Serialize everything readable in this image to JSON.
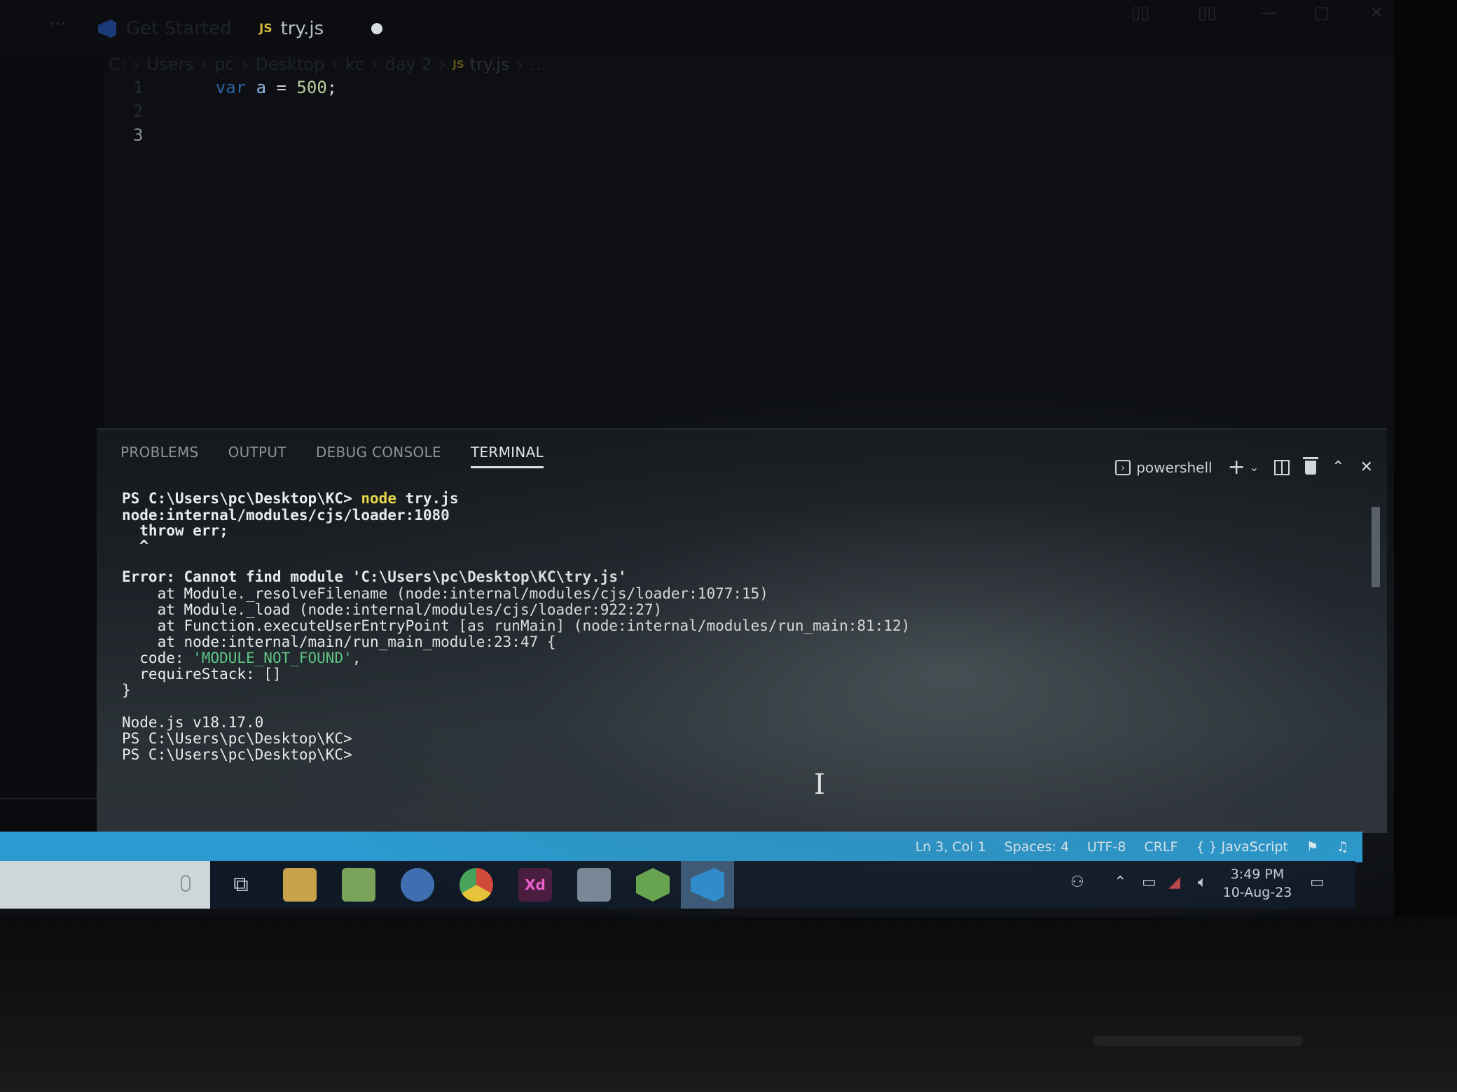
{
  "titlebar": {
    "tabs": [
      {
        "label": "Get Started",
        "icon": "vscode-icon"
      },
      {
        "label": "try.js",
        "badge": "JS",
        "icon": "js-file-icon",
        "dirty": true
      }
    ]
  },
  "breadcrumb": [
    "C:",
    "Users",
    "pc",
    "Desktop",
    "kc",
    "day 2",
    "try.js",
    "..."
  ],
  "breadcrumb_badge": "JS",
  "editor": {
    "line_numbers": [
      "1",
      "2",
      "3"
    ],
    "code": {
      "keyword": "var",
      "identifier": "a",
      "operator": "=",
      "number": "500",
      "terminator": ";"
    }
  },
  "panel": {
    "tabs": [
      "PROBLEMS",
      "OUTPUT",
      "DEBUG CONSOLE",
      "TERMINAL"
    ],
    "active_tab": "TERMINAL",
    "shell": "powershell"
  },
  "terminal": {
    "prompt": "PS C:\\Users\\pc\\Desktop\\KC>",
    "command_name": "node",
    "command_arg": "try.js",
    "lines": [
      "node:internal/modules/cjs/loader:1080",
      "  throw err;",
      "  ^",
      "Error: Cannot find module 'C:\\Users\\pc\\Desktop\\KC\\try.js'",
      "    at Module._resolveFilename (node:internal/modules/cjs/loader:1077:15)",
      "    at Module._load (node:internal/modules/cjs/loader:922:27)",
      "    at Function.executeUserEntryPoint [as runMain] (node:internal/modules/run_main:81:12)",
      "    at node:internal/main/run_main_module:23:47 {",
      "  code: ",
      "'MODULE_NOT_FOUND'",
      ",",
      "  requireStack: []",
      "}",
      "Node.js v18.17.0"
    ]
  },
  "statusbar": {
    "cursor": "Ln 3, Col 1",
    "spaces": "Spaces: 4",
    "encoding": "UTF-8",
    "eol": "CRLF",
    "language": "{ } JavaScript"
  },
  "taskbar": {
    "time": "3:49 PM",
    "date": "10-Aug-23",
    "apps": [
      "task-view-icon",
      "file-explorer-icon",
      "maps-icon",
      "media-player-icon",
      "chrome-icon",
      "adobe-xd-icon",
      "printer-icon",
      "nodejs-icon",
      "vscode-icon"
    ]
  },
  "colors": {
    "statusbar": "#2a9bd0",
    "js_badge": "#cbb83b",
    "string": "#5fc986",
    "command": "#e8d84a"
  }
}
